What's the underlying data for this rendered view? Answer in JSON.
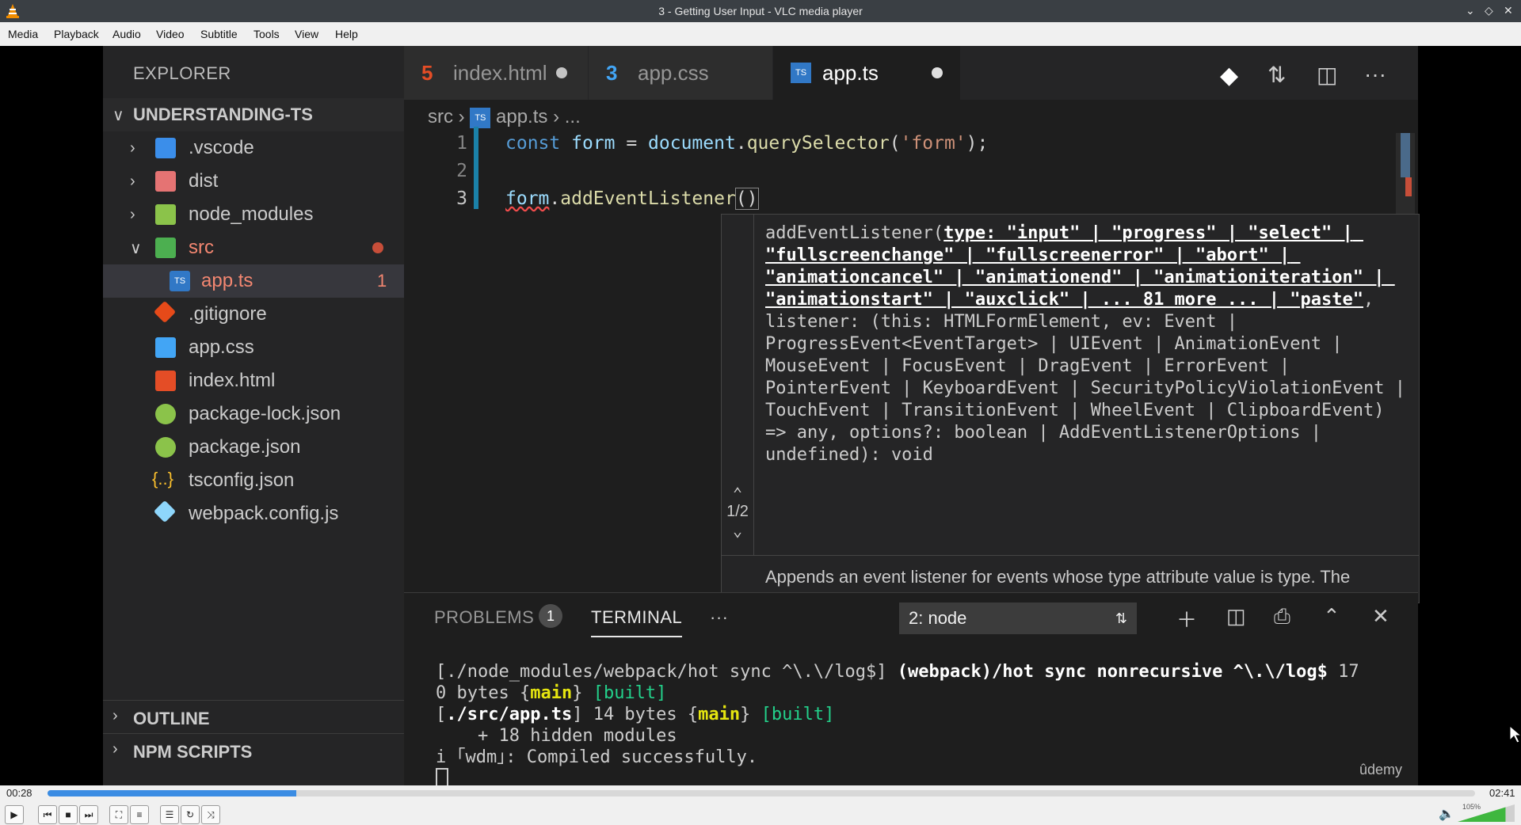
{
  "window": {
    "title": "3 - Getting User Input - VLC media player"
  },
  "menu": [
    "Media",
    "Playback",
    "Audio",
    "Video",
    "Subtitle",
    "Tools",
    "View",
    "Help"
  ],
  "sidebar": {
    "header": "EXPLORER",
    "project": "UNDERSTANDING-TS",
    "items": [
      {
        "label": ".vscode"
      },
      {
        "label": "dist"
      },
      {
        "label": "node_modules"
      },
      {
        "label": "src"
      },
      {
        "label": "app.ts",
        "badge": "1"
      },
      {
        "label": ".gitignore"
      },
      {
        "label": "app.css"
      },
      {
        "label": "index.html"
      },
      {
        "label": "package-lock.json"
      },
      {
        "label": "package.json"
      },
      {
        "label": "tsconfig.json"
      },
      {
        "label": "webpack.config.js"
      }
    ],
    "outline": "OUTLINE",
    "npm_scripts": "NPM SCRIPTS"
  },
  "tabs": [
    {
      "label": "index.html",
      "icon": "5"
    },
    {
      "label": "app.css",
      "icon": "3"
    },
    {
      "label": "app.ts",
      "icon": "TS"
    }
  ],
  "breadcrumb": {
    "folder": "src",
    "icon": "TS",
    "file": "app.ts",
    "rest": "..."
  },
  "code": {
    "line_numbers": [
      "1",
      "2",
      "3"
    ],
    "line1": {
      "kw": "const",
      "var": "form",
      "eq": " = ",
      "obj": "document",
      "dot": ".",
      "fn": "querySelector",
      "open": "(",
      "str": "'form'",
      "close": ");"
    },
    "line3": {
      "var": "form",
      "dot": ".",
      "fn": "addEventListener",
      "parens": "()"
    }
  },
  "hover": {
    "signature_start": "addEventListener(",
    "type_param": "type: \"input\" | \"progress\" | \"select\" | \"fullscreenchange\" | \"fullscreenerror\" | \"abort\" | \"animationcancel\" | \"animationend\" | \"animationiteration\" | \"animationstart\" | \"auxclick\" | ... 81 more ... | \"paste\"",
    "signature_rest": ", listener: (this: HTMLFormElement, ev: Event | ProgressEvent<EventTarget> | UIEvent | AnimationEvent | MouseEvent | FocusEvent | DragEvent | ErrorEvent | PointerEvent | KeyboardEvent | SecurityPolicyViolationEvent | TouchEvent | TransitionEvent | WheelEvent | ClipboardEvent) => any, options?: boolean | AddEventListenerOptions | undefined): void",
    "overload": "1/2",
    "doc": "Appends an event listener for events whose type attribute value is type. The"
  },
  "panel": {
    "problems": "PROBLEMS",
    "problems_count": "1",
    "terminal": "TERMINAL",
    "more": "···",
    "terminal_select": "2: node",
    "terminal_lines": {
      "l1a": "[./node_modules/webpack/hot sync ^\\.\\/log$] ",
      "l1b": "(webpack)/hot sync nonrecursive ^\\.\\/log$",
      "l1c": " 17",
      "l2a": "0 bytes {",
      "l2b": "main",
      "l2c": "} ",
      "l2d": "[built]",
      "l3a": "[",
      "l3b": "./src/app.ts",
      "l3c": "] 14 bytes {",
      "l3d": "main",
      "l3e": "} ",
      "l3f": "[built]",
      "l4": "    + 18 hidden modules",
      "l5": "i ｢wdm｣: Compiled successfully."
    }
  },
  "watermark": "ûdemy",
  "player": {
    "elapsed": "00:28",
    "total": "02:41",
    "progress_fraction": 0.174,
    "volume_percent": 105,
    "volume_label": "105%",
    "accent": "#3b8ce3"
  }
}
